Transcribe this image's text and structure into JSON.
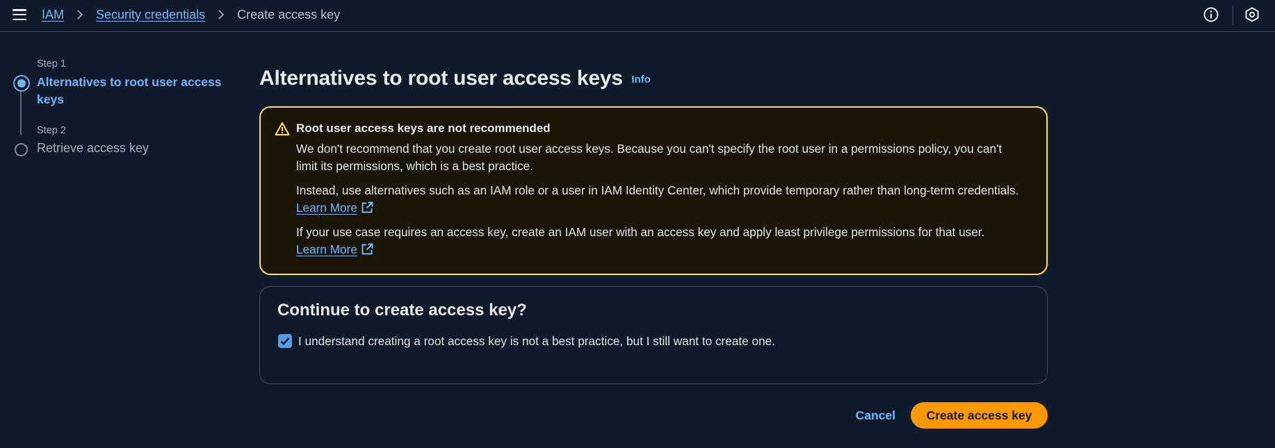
{
  "header": {
    "menu_icon": "hamburger-menu-icon",
    "breadcrumbs": [
      {
        "label": "IAM",
        "link": true
      },
      {
        "label": "Security credentials",
        "link": true
      },
      {
        "label": "Create access key",
        "link": false
      }
    ],
    "icons": [
      "info-icon",
      "settings-hexagon-icon"
    ]
  },
  "steps": [
    {
      "label": "Step 1",
      "title": "Alternatives to root user access keys",
      "active": true
    },
    {
      "label": "Step 2",
      "title": "Retrieve access key",
      "active": false
    }
  ],
  "main": {
    "title": "Alternatives to root user access keys",
    "info_link": "Info",
    "warning": {
      "title": "Root user access keys are not recommended",
      "p1": "We don't recommend that you create root user access keys. Because you can't specify the root user in a permissions policy, you can't limit its permissions, which is a best practice.",
      "p2": "Instead, use alternatives such as an IAM role or a user in IAM Identity Center, which provide temporary rather than long-term credentials.",
      "p2_link": "Learn More",
      "p3": "If your use case requires an access key, create an IAM user with an access key and apply least privilege permissions for that user.",
      "p3_link": "Learn More"
    },
    "confirm": {
      "title": "Continue to create access key?",
      "checkbox_checked": true,
      "checkbox_label": "I understand creating a root access key is not a best practice, but I still want to create one."
    },
    "actions": {
      "cancel_label": "Cancel",
      "create_label": "Create access key"
    }
  },
  "colors": {
    "background": "#0f1b2a",
    "link": "#6fb6ff",
    "warning_border": "#ffe347",
    "primary_button": "#ff9900",
    "checkbox": "#539fe5"
  }
}
